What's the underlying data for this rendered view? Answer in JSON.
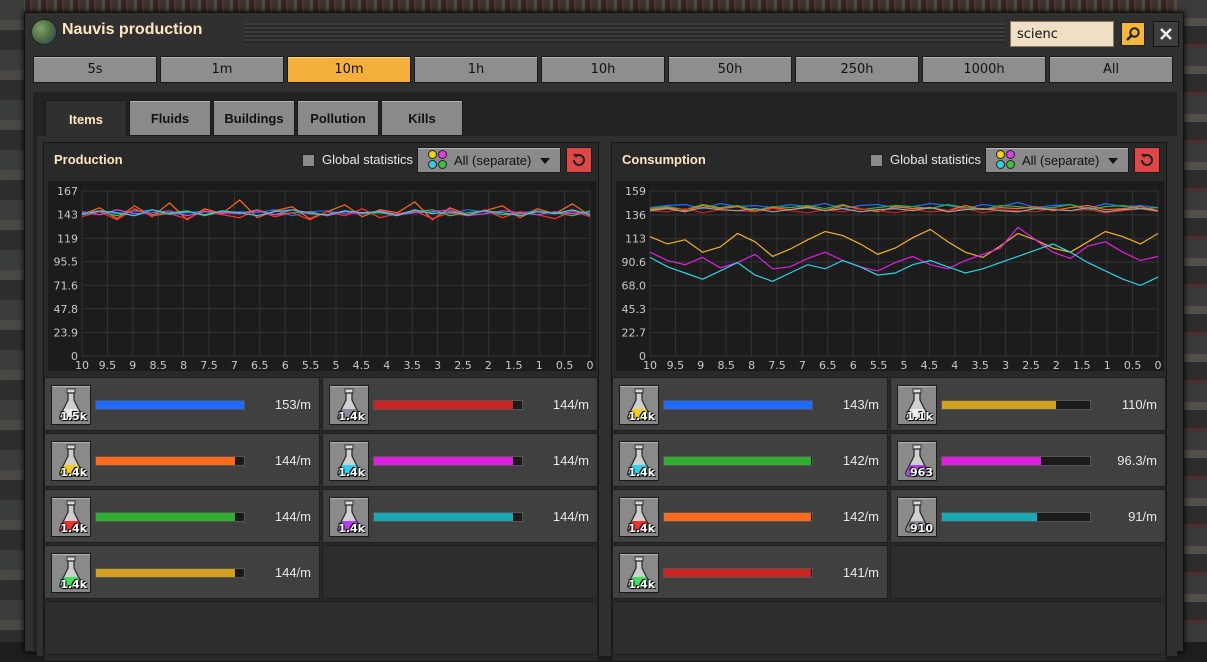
{
  "window": {
    "title": "Nauvis production",
    "search_value": "scienc"
  },
  "time_buttons": [
    "5s",
    "1m",
    "10m",
    "1h",
    "10h",
    "50h",
    "250h",
    "1000h",
    "All"
  ],
  "time_active_index": 2,
  "tabs": [
    "Items",
    "Fluids",
    "Buildings",
    "Pollution",
    "Kills"
  ],
  "tab_active_index": 0,
  "production": {
    "title": "Production",
    "global_label": "Global statistics",
    "dropdown_label": "All (separate)",
    "chart_data": {
      "type": "line",
      "y_ticks": [
        "167",
        "143",
        "119",
        "95.5",
        "71.6",
        "47.8",
        "23.9",
        "0"
      ],
      "x_ticks": [
        "10",
        "9.5",
        "9",
        "8.5",
        "8",
        "7.5",
        "7",
        "6.5",
        "6",
        "5.5",
        "5",
        "4.5",
        "4",
        "3.5",
        "3",
        "2.5",
        "2",
        "1.5",
        "1",
        "0.5",
        "0"
      ],
      "ylim": [
        0,
        167
      ],
      "xlim": [
        10,
        0
      ],
      "series": [
        {
          "color": "#1f6bff",
          "values": [
            145,
            147,
            144,
            146,
            148,
            143,
            145,
            147,
            144,
            146,
            145,
            148,
            142,
            146,
            147,
            144,
            145,
            146,
            143,
            147,
            145,
            144,
            148,
            146,
            143,
            145,
            147,
            144,
            146,
            145
          ]
        },
        {
          "color": "#ff6a1a",
          "values": [
            143,
            150,
            139,
            152,
            141,
            155,
            138,
            149,
            144,
            158,
            140,
            147,
            151,
            139,
            146,
            153,
            141,
            148,
            145,
            156,
            138,
            150,
            143,
            147,
            152,
            140,
            149,
            144,
            154,
            142
          ]
        },
        {
          "color": "#40c040",
          "values": [
            144,
            146,
            142,
            148,
            143,
            145,
            147,
            142,
            146,
            144,
            148,
            143,
            145,
            146,
            142,
            147,
            144,
            145,
            143,
            146,
            148,
            142,
            145,
            147,
            143,
            144,
            146,
            145,
            142,
            147
          ]
        },
        {
          "color": "#ff3030",
          "values": [
            141,
            146,
            138,
            149,
            142,
            144,
            139,
            147,
            143,
            140,
            148,
            141,
            145,
            138,
            146,
            142,
            149,
            140,
            144,
            147,
            139,
            145,
            142,
            148,
            140,
            146,
            143,
            139,
            147,
            141
          ]
        },
        {
          "color": "#e040e0",
          "values": [
            146,
            143,
            148,
            144,
            145,
            147,
            142,
            146,
            145,
            144,
            147,
            143,
            148,
            145,
            142,
            146,
            144,
            147,
            143,
            145,
            146,
            148,
            142,
            144,
            147,
            145,
            143,
            146,
            144,
            145
          ]
        },
        {
          "color": "#30d0e0",
          "values": [
            143,
            147,
            145,
            142,
            148,
            144,
            146,
            143,
            147,
            145,
            142,
            146,
            148,
            144,
            143,
            147,
            145,
            146,
            142,
            148,
            144,
            146,
            143,
            147,
            145,
            142,
            146,
            144,
            148,
            143
          ]
        }
      ]
    },
    "items": [
      {
        "icon": "automation-science-pack-icon",
        "count": "1.5k",
        "rate": "153/m",
        "bar_color": "#1f6bff",
        "bar_fraction": 1.0
      },
      {
        "icon": "military-science-pack-icon",
        "count": "1.4k",
        "rate": "144/m",
        "bar_color": "#cc2222",
        "bar_fraction": 0.94
      },
      {
        "icon": "logistic-science-pack-icon",
        "count": "1.4k",
        "rate": "144/m",
        "bar_color": "#ff6a1a",
        "bar_fraction": 0.94
      },
      {
        "icon": "utility-science-pack-icon",
        "count": "1.4k",
        "rate": "144/m",
        "bar_color": "#e020e0",
        "bar_fraction": 0.94
      },
      {
        "icon": "chemical-science-pack-icon",
        "count": "1.4k",
        "rate": "144/m",
        "bar_color": "#30b030",
        "bar_fraction": 0.94
      },
      {
        "icon": "production-science-pack-icon",
        "count": "1.4k",
        "rate": "144/m",
        "bar_color": "#18a8b8",
        "bar_fraction": 0.94
      },
      {
        "icon": "space-science-pack-icon",
        "count": "1.4k",
        "rate": "144/m",
        "bar_color": "#d4a020",
        "bar_fraction": 0.94
      }
    ]
  },
  "consumption": {
    "title": "Consumption",
    "global_label": "Global statistics",
    "dropdown_label": "All (separate)",
    "chart_data": {
      "type": "line",
      "y_ticks": [
        "159",
        "136",
        "113",
        "90.6",
        "68.0",
        "45.3",
        "22.7",
        "0"
      ],
      "x_ticks": [
        "10",
        "9.5",
        "9",
        "8.5",
        "8",
        "7.5",
        "7",
        "6.5",
        "6",
        "5.5",
        "5",
        "4.5",
        "4",
        "3.5",
        "3",
        "2.5",
        "2",
        "1.5",
        "1",
        "0.5",
        "0"
      ],
      "ylim": [
        0,
        159
      ],
      "xlim": [
        10,
        0
      ],
      "series": [
        {
          "color": "#1f6bff",
          "values": [
            143,
            145,
            146,
            142,
            147,
            144,
            145,
            143,
            146,
            144,
            147,
            142,
            145,
            146,
            143,
            144,
            147,
            145,
            142,
            146,
            144,
            148,
            143,
            145,
            146,
            142,
            147,
            144,
            145,
            143
          ]
        },
        {
          "color": "#30b030",
          "values": [
            142,
            144,
            141,
            146,
            143,
            145,
            140,
            144,
            143,
            145,
            142,
            146,
            141,
            143,
            145,
            144,
            142,
            146,
            143,
            141,
            145,
            144,
            142,
            143,
            146,
            141,
            144,
            145,
            142,
            143
          ]
        },
        {
          "color": "#ff6a1a",
          "values": [
            141,
            143,
            140,
            145,
            142,
            144,
            139,
            143,
            141,
            144,
            140,
            145,
            142,
            139,
            144,
            142,
            143,
            140,
            145,
            141,
            143,
            142,
            144,
            140,
            143,
            145,
            141,
            142,
            144,
            140
          ]
        },
        {
          "color": "#cc2222",
          "values": [
            140,
            139,
            142,
            138,
            141,
            140,
            139,
            142,
            140,
            138,
            141,
            139,
            142,
            140,
            138,
            141,
            139,
            140,
            142,
            138,
            141,
            140,
            139,
            142,
            140,
            141,
            138,
            140,
            142,
            139
          ]
        },
        {
          "color": "#f0b030",
          "values": [
            115,
            108,
            112,
            100,
            105,
            118,
            110,
            96,
            103,
            112,
            120,
            116,
            108,
            98,
            104,
            114,
            122,
            110,
            100,
            95,
            106,
            118,
            112,
            104,
            100,
            110,
            120,
            115,
            108,
            118
          ]
        },
        {
          "color": "#e020e0",
          "values": [
            100,
            92,
            88,
            95,
            85,
            90,
            98,
            84,
            86,
            94,
            100,
            92,
            86,
            82,
            90,
            96,
            88,
            84,
            92,
            98,
            104,
            124,
            112,
            100,
            94,
            106,
            110,
            100,
            92,
            96
          ]
        },
        {
          "color": "#30d0e0",
          "values": [
            95,
            86,
            80,
            74,
            82,
            90,
            78,
            72,
            80,
            88,
            84,
            92,
            86,
            78,
            80,
            88,
            92,
            86,
            80,
            84,
            90,
            96,
            102,
            108,
            100,
            90,
            82,
            74,
            68,
            76
          ]
        },
        {
          "color": "#a0a0a0",
          "values": [
            140,
            142,
            139,
            143,
            141,
            140,
            142,
            139,
            141,
            143,
            140,
            142,
            139,
            141,
            142,
            140,
            143,
            139,
            141,
            142,
            140,
            139,
            142,
            141,
            140,
            143,
            139,
            141,
            142,
            140
          ]
        }
      ]
    },
    "items": [
      {
        "icon": "chemical-science-pack-icon-yellow",
        "count": "1.4k",
        "rate": "143/m",
        "bar_color": "#1f6bff",
        "bar_fraction": 1.0
      },
      {
        "icon": "space-science-pack-icon-white",
        "count": "1.1k",
        "rate": "110/m",
        "bar_color": "#d4a020",
        "bar_fraction": 0.77
      },
      {
        "icon": "utility-science-pack-icon",
        "count": "1.4k",
        "rate": "142/m",
        "bar_color": "#30b030",
        "bar_fraction": 0.99
      },
      {
        "icon": "production-science-pack-icon",
        "count": "963",
        "rate": "96.3/m",
        "bar_color": "#e020e0",
        "bar_fraction": 0.67
      },
      {
        "icon": "logistic-science-pack-icon-red",
        "count": "1.4k",
        "rate": "142/m",
        "bar_color": "#ff6a1a",
        "bar_fraction": 0.99
      },
      {
        "icon": "military-science-pack-icon",
        "count": "910",
        "rate": "91/m",
        "bar_color": "#18a8b8",
        "bar_fraction": 0.64
      },
      {
        "icon": "chemical-science-pack-icon-green",
        "count": "1.4k",
        "rate": "141/m",
        "bar_color": "#cc2222",
        "bar_fraction": 0.99
      }
    ]
  }
}
